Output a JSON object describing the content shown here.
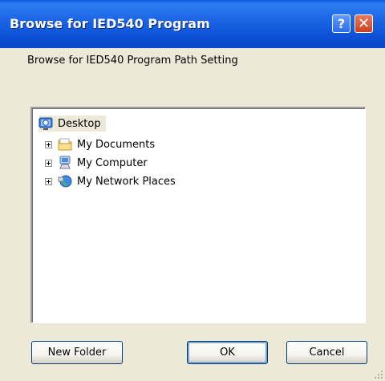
{
  "window": {
    "title": "Browse for IED540 Program",
    "help_label": "?",
    "close_label": "✕"
  },
  "prompt": "Browse for IED540 Program Path Setting",
  "tree": {
    "root": {
      "label": "Desktop",
      "icon": "desktop-icon"
    },
    "items": [
      {
        "label": "My Documents",
        "icon": "folder-icon"
      },
      {
        "label": "My Computer",
        "icon": "computer-icon"
      },
      {
        "label": "My Network Places",
        "icon": "network-places-icon"
      }
    ]
  },
  "buttons": {
    "new_folder": "New Folder",
    "ok": "OK",
    "cancel": "Cancel"
  },
  "colors": {
    "titlebar": "#0A4FD4",
    "dialog_bg": "#ECE9D8",
    "close_button": "#C8411F"
  }
}
